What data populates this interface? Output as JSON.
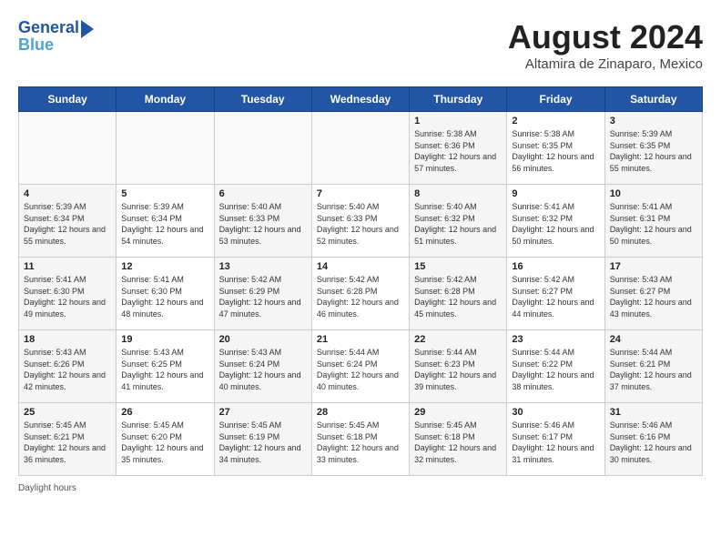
{
  "header": {
    "logo_line1": "General",
    "logo_line2": "Blue",
    "month_title": "August 2024",
    "subtitle": "Altamira de Zinaparo, Mexico"
  },
  "days_of_week": [
    "Sunday",
    "Monday",
    "Tuesday",
    "Wednesday",
    "Thursday",
    "Friday",
    "Saturday"
  ],
  "weeks": [
    [
      {
        "day": "",
        "info": ""
      },
      {
        "day": "",
        "info": ""
      },
      {
        "day": "",
        "info": ""
      },
      {
        "day": "",
        "info": ""
      },
      {
        "day": "1",
        "info": "Sunrise: 5:38 AM\nSunset: 6:36 PM\nDaylight: 12 hours and 57 minutes."
      },
      {
        "day": "2",
        "info": "Sunrise: 5:38 AM\nSunset: 6:35 PM\nDaylight: 12 hours and 56 minutes."
      },
      {
        "day": "3",
        "info": "Sunrise: 5:39 AM\nSunset: 6:35 PM\nDaylight: 12 hours and 55 minutes."
      }
    ],
    [
      {
        "day": "4",
        "info": "Sunrise: 5:39 AM\nSunset: 6:34 PM\nDaylight: 12 hours and 55 minutes."
      },
      {
        "day": "5",
        "info": "Sunrise: 5:39 AM\nSunset: 6:34 PM\nDaylight: 12 hours and 54 minutes."
      },
      {
        "day": "6",
        "info": "Sunrise: 5:40 AM\nSunset: 6:33 PM\nDaylight: 12 hours and 53 minutes."
      },
      {
        "day": "7",
        "info": "Sunrise: 5:40 AM\nSunset: 6:33 PM\nDaylight: 12 hours and 52 minutes."
      },
      {
        "day": "8",
        "info": "Sunrise: 5:40 AM\nSunset: 6:32 PM\nDaylight: 12 hours and 51 minutes."
      },
      {
        "day": "9",
        "info": "Sunrise: 5:41 AM\nSunset: 6:32 PM\nDaylight: 12 hours and 50 minutes."
      },
      {
        "day": "10",
        "info": "Sunrise: 5:41 AM\nSunset: 6:31 PM\nDaylight: 12 hours and 50 minutes."
      }
    ],
    [
      {
        "day": "11",
        "info": "Sunrise: 5:41 AM\nSunset: 6:30 PM\nDaylight: 12 hours and 49 minutes."
      },
      {
        "day": "12",
        "info": "Sunrise: 5:41 AM\nSunset: 6:30 PM\nDaylight: 12 hours and 48 minutes."
      },
      {
        "day": "13",
        "info": "Sunrise: 5:42 AM\nSunset: 6:29 PM\nDaylight: 12 hours and 47 minutes."
      },
      {
        "day": "14",
        "info": "Sunrise: 5:42 AM\nSunset: 6:28 PM\nDaylight: 12 hours and 46 minutes."
      },
      {
        "day": "15",
        "info": "Sunrise: 5:42 AM\nSunset: 6:28 PM\nDaylight: 12 hours and 45 minutes."
      },
      {
        "day": "16",
        "info": "Sunrise: 5:42 AM\nSunset: 6:27 PM\nDaylight: 12 hours and 44 minutes."
      },
      {
        "day": "17",
        "info": "Sunrise: 5:43 AM\nSunset: 6:27 PM\nDaylight: 12 hours and 43 minutes."
      }
    ],
    [
      {
        "day": "18",
        "info": "Sunrise: 5:43 AM\nSunset: 6:26 PM\nDaylight: 12 hours and 42 minutes."
      },
      {
        "day": "19",
        "info": "Sunrise: 5:43 AM\nSunset: 6:25 PM\nDaylight: 12 hours and 41 minutes."
      },
      {
        "day": "20",
        "info": "Sunrise: 5:43 AM\nSunset: 6:24 PM\nDaylight: 12 hours and 40 minutes."
      },
      {
        "day": "21",
        "info": "Sunrise: 5:44 AM\nSunset: 6:24 PM\nDaylight: 12 hours and 40 minutes."
      },
      {
        "day": "22",
        "info": "Sunrise: 5:44 AM\nSunset: 6:23 PM\nDaylight: 12 hours and 39 minutes."
      },
      {
        "day": "23",
        "info": "Sunrise: 5:44 AM\nSunset: 6:22 PM\nDaylight: 12 hours and 38 minutes."
      },
      {
        "day": "24",
        "info": "Sunrise: 5:44 AM\nSunset: 6:21 PM\nDaylight: 12 hours and 37 minutes."
      }
    ],
    [
      {
        "day": "25",
        "info": "Sunrise: 5:45 AM\nSunset: 6:21 PM\nDaylight: 12 hours and 36 minutes."
      },
      {
        "day": "26",
        "info": "Sunrise: 5:45 AM\nSunset: 6:20 PM\nDaylight: 12 hours and 35 minutes."
      },
      {
        "day": "27",
        "info": "Sunrise: 5:45 AM\nSunset: 6:19 PM\nDaylight: 12 hours and 34 minutes."
      },
      {
        "day": "28",
        "info": "Sunrise: 5:45 AM\nSunset: 6:18 PM\nDaylight: 12 hours and 33 minutes."
      },
      {
        "day": "29",
        "info": "Sunrise: 5:45 AM\nSunset: 6:18 PM\nDaylight: 12 hours and 32 minutes."
      },
      {
        "day": "30",
        "info": "Sunrise: 5:46 AM\nSunset: 6:17 PM\nDaylight: 12 hours and 31 minutes."
      },
      {
        "day": "31",
        "info": "Sunrise: 5:46 AM\nSunset: 6:16 PM\nDaylight: 12 hours and 30 minutes."
      }
    ]
  ],
  "footer": {
    "note": "Daylight hours"
  }
}
